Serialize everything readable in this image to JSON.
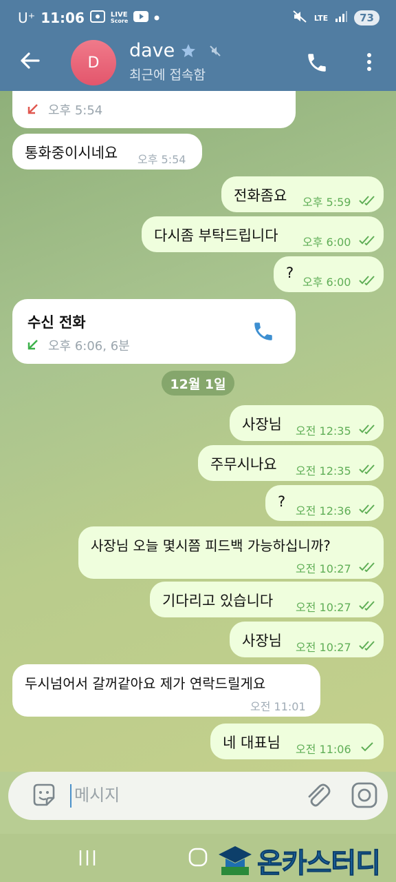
{
  "status_bar": {
    "carrier": "U⁺",
    "time": "11:06",
    "live_badge": "LIVE",
    "live_sub": "Score",
    "network": "LTE",
    "battery": "73"
  },
  "header": {
    "avatar_letter": "D",
    "contact_name": "dave",
    "status": "최근에 접속함",
    "avatar_color": "#e3566c",
    "bar_color": "#517da2"
  },
  "messages": [
    {
      "id": "m0",
      "text": "",
      "time": "오후 5:54"
    },
    {
      "id": "m1",
      "text": "통화중이시네요",
      "time": "오후 5:54"
    },
    {
      "id": "m2",
      "text": "전화좀요",
      "time": "오후 5:59"
    },
    {
      "id": "m3",
      "text": "다시좀 부탁드립니다",
      "time": "오후 6:00"
    },
    {
      "id": "m4",
      "text": "?",
      "time": "오후 6:00"
    },
    {
      "id": "m5",
      "title": "수신 전화",
      "meta": "오후 6:06, 6분"
    },
    {
      "id": "m6",
      "text": "사장님",
      "time": "오전 12:35"
    },
    {
      "id": "m7",
      "text": "주무시나요",
      "time": "오전 12:35"
    },
    {
      "id": "m8",
      "text": "?",
      "time": "오전 12:36"
    },
    {
      "id": "m9",
      "text": "사장님 오늘 몇시쯤 피드백 가능하십니까?",
      "time": "오전 10:27"
    },
    {
      "id": "m10",
      "text": "기다리고 있습니다",
      "time": "오전 10:27"
    },
    {
      "id": "m11",
      "text": "사장님",
      "time": "오전 10:27"
    },
    {
      "id": "m12",
      "text": "두시넘어서 갈꺼같아요 제가 연락드릴게요",
      "time": "오전 11:01"
    },
    {
      "id": "m13",
      "text": "네 대표님",
      "time": "오전 11:06"
    }
  ],
  "date_separator": "12월 1일",
  "composer": {
    "placeholder": "메시지"
  },
  "watermark": {
    "text": "온카스터디"
  },
  "icons": {
    "back": "arrow-left-icon",
    "call": "phone-icon",
    "more": "more-vertical-icon",
    "sticker": "sticker-icon",
    "attach": "paperclip-icon",
    "camera": "camera-icon"
  },
  "colors": {
    "incoming_bubble": "#ffffff",
    "outgoing_bubble": "#effedd",
    "outgoing_time": "#5fae56",
    "missed_arrow": "#e0574f",
    "received_arrow": "#3cb14a",
    "call_icon": "#3d8fd1"
  }
}
